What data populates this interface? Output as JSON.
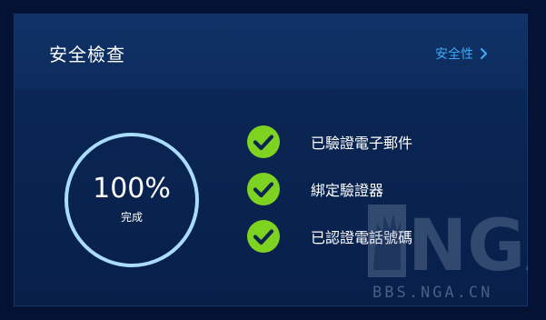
{
  "card": {
    "title": "安全檢查",
    "link_label": "安全性"
  },
  "progress": {
    "value": "100%",
    "label": "完成",
    "fraction": 1.0
  },
  "checks": [
    {
      "label": "已驗證電子郵件",
      "icon": "check-circle-icon"
    },
    {
      "label": "綁定驗證器",
      "icon": "check-circle-icon"
    },
    {
      "label": "已認證電話號碼",
      "icon": "check-circle-icon"
    }
  ],
  "watermark": {
    "logo_text": "NGA",
    "site": "BBS.NGA.CN"
  },
  "colors": {
    "accent_link": "#3aa8f5",
    "check_green": "#7ed321",
    "ring": "#a9dcff"
  }
}
